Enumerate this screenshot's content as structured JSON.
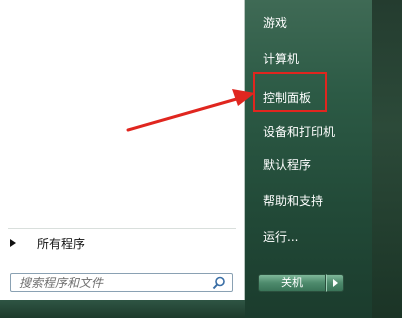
{
  "start_menu": {
    "right_items": [
      {
        "label": "游戏"
      },
      {
        "label": "计算机"
      },
      {
        "label": "控制面板"
      },
      {
        "label": "设备和打印机"
      },
      {
        "label": "默认程序"
      },
      {
        "label": "帮助和支持"
      },
      {
        "label": "运行..."
      }
    ],
    "all_programs_label": "所有程序",
    "search_placeholder": "搜索程序和文件",
    "shutdown_label": "关机"
  },
  "annotation": {
    "highlight_color": "#e0261f",
    "target": "控制面板"
  },
  "icons": [
    "search-icon",
    "triangle-right-icon",
    "chevron-right-icon"
  ]
}
